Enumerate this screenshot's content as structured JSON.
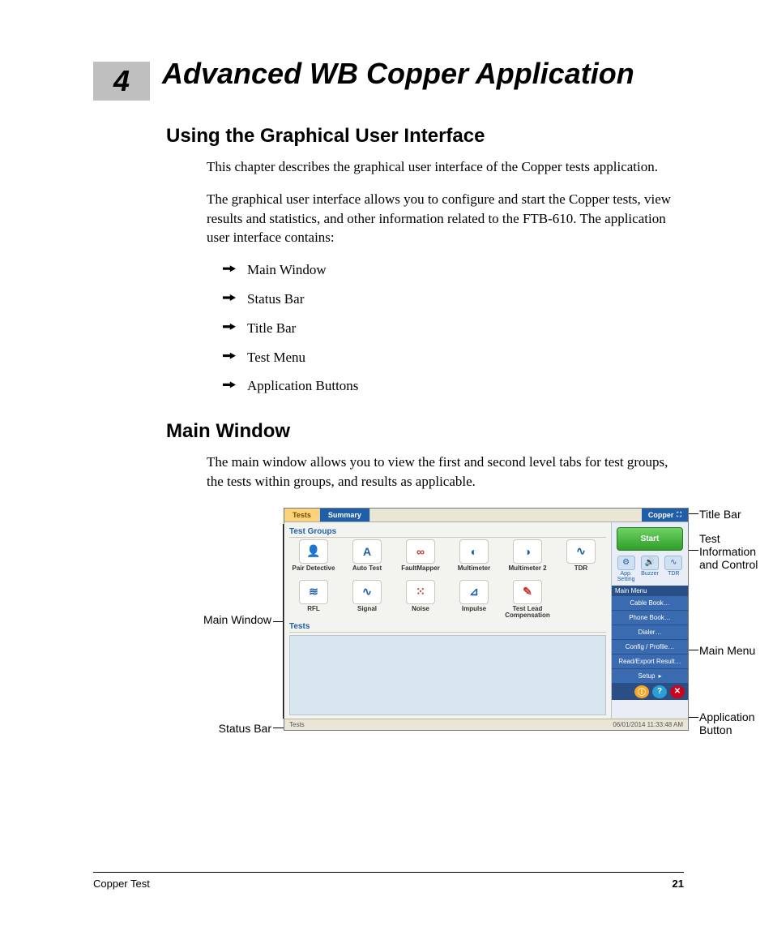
{
  "chapter": {
    "number": "4",
    "title": "Advanced WB Copper Application"
  },
  "section1": {
    "heading": "Using the Graphical User Interface",
    "para1": "This chapter describes the graphical user interface of the Copper tests application.",
    "para2": "The graphical user interface allows you to configure and start the Copper tests, view results and statistics, and other information related to the FTB-610. The application user interface contains:",
    "bullets": [
      "Main Window",
      "Status Bar",
      "Title Bar",
      "Test Menu",
      "Application Buttons"
    ]
  },
  "section2": {
    "heading": "Main Window",
    "para1": "The main window allows you to view the first and second level tabs for test groups, the tests within groups, and results as applicable."
  },
  "callouts": {
    "title_bar": "Title Bar",
    "test_info": "Test Information and Control",
    "main_menu": "Main Menu",
    "app_button": "Application Button",
    "main_window": "Main Window",
    "status_bar": "Status Bar"
  },
  "app": {
    "tabs": {
      "tests": "Tests",
      "summary": "Summary"
    },
    "title": "Copper",
    "group_label": "Test Groups",
    "tests_label": "Tests",
    "row1": [
      {
        "label": "Pair Detective",
        "glyph": "👤"
      },
      {
        "label": "Auto Test",
        "glyph": "A"
      },
      {
        "label": "FaultMapper",
        "glyph": "∞"
      },
      {
        "label": "Multimeter",
        "glyph": "◐"
      },
      {
        "label": "Multimeter 2",
        "glyph": "◑"
      },
      {
        "label": "TDR",
        "glyph": "∿"
      }
    ],
    "row2": [
      {
        "label": "RFL",
        "glyph": "≋"
      },
      {
        "label": "Signal",
        "glyph": "∿"
      },
      {
        "label": "Noise",
        "glyph": "⁙"
      },
      {
        "label": "Impulse",
        "glyph": "⊿"
      },
      {
        "label": "Test Lead Compensation",
        "glyph": "✎"
      }
    ],
    "start": "Start",
    "side_minis": [
      {
        "label": "App. Setting",
        "glyph": "⚙"
      },
      {
        "label": "Buzzer",
        "glyph": "🔊"
      },
      {
        "label": "TDR",
        "glyph": "∿"
      }
    ],
    "menu_header": "Main Menu",
    "menu_items": [
      "Cable Book…",
      "Phone Book…",
      "Dialer…",
      "Config / Profile…",
      "Read/Export Result…"
    ],
    "setup": "Setup",
    "status_left": "Tests",
    "status_right": "06/01/2014 11:33:48 AM",
    "footer_btns": [
      "ⓘ",
      "?",
      "✕"
    ]
  },
  "footer": {
    "left": "Copper Test",
    "page": "21"
  }
}
